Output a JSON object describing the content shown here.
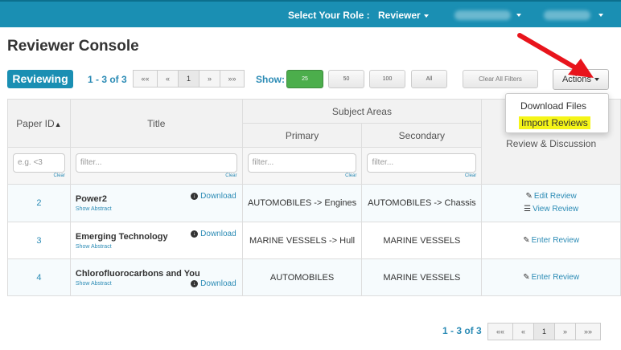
{
  "topbar": {
    "role_label": "Select Your Role :",
    "role_value": "Reviewer"
  },
  "page": {
    "title": "Reviewer Console"
  },
  "toolbar": {
    "tab_label": "Reviewing",
    "count_text": "1 - 3 of 3",
    "pager": [
      "««",
      "«",
      "1",
      "»",
      "»»"
    ],
    "show_label": "Show:",
    "show_options": [
      "25",
      "50",
      "100",
      "All"
    ],
    "show_selected": "25",
    "clear_filters": "Clear All Filters",
    "actions_label": "Actions"
  },
  "actions_menu": {
    "items": [
      "Download Files",
      "Import Reviews"
    ],
    "highlighted": "Import Reviews",
    "highlight_color": "#f5f518"
  },
  "table": {
    "headers": {
      "paper_id": "Paper ID",
      "title": "Title",
      "subject_areas": "Subject Areas",
      "primary": "Primary",
      "secondary": "Secondary",
      "review": "Review & Discussion"
    },
    "filters": {
      "paper_id_placeholder": "e.g. <3",
      "title_placeholder": "filter...",
      "primary_placeholder": "filter...",
      "secondary_placeholder": "filter...",
      "clear_label": "Clear"
    },
    "rows": [
      {
        "id": "2",
        "title": "Power2",
        "show_abstract": "Show Abstract",
        "download": "Download",
        "primary": "AUTOMOBILES -> Engines",
        "secondary": "AUTOMOBILES -> Chassis",
        "review_links": [
          "Edit Review",
          "View Review"
        ]
      },
      {
        "id": "3",
        "title": "Emerging Technology",
        "show_abstract": "Show Abstract",
        "download": "Download",
        "primary": "MARINE VESSELS -> Hull",
        "secondary": "MARINE VESSELS",
        "review_links": [
          "Enter Review"
        ]
      },
      {
        "id": "4",
        "title": "Chlorofluorocarbons and You",
        "show_abstract": "Show Abstract",
        "download": "Download",
        "primary": "AUTOMOBILES",
        "secondary": "MARINE VESSELS",
        "review_links": [
          "Enter Review"
        ]
      }
    ]
  },
  "footer": {
    "count_text": "1 - 3 of 3",
    "pager": [
      "««",
      "«",
      "1",
      "»",
      "»»"
    ]
  },
  "colors": {
    "brand": "#1a8fb3",
    "link": "#2b8bb5",
    "show_active": "#4cae4c",
    "annotation_arrow": "#e8141c"
  }
}
